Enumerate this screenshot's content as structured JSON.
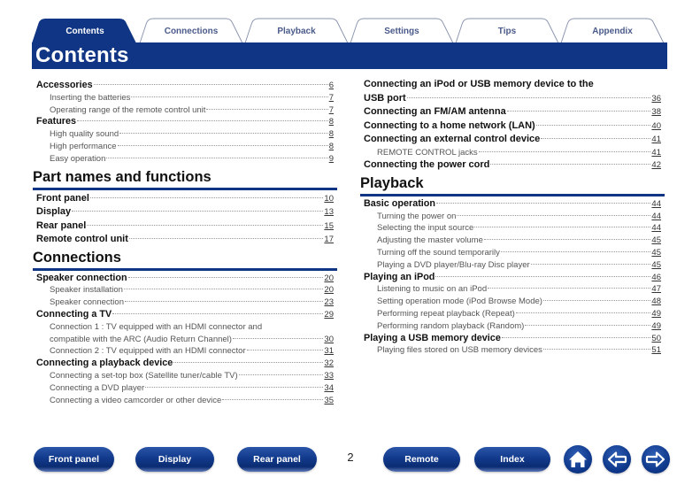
{
  "tabs": [
    {
      "label": "Contents",
      "active": true
    },
    {
      "label": "Connections",
      "active": false
    },
    {
      "label": "Playback",
      "active": false
    },
    {
      "label": "Settings",
      "active": false
    },
    {
      "label": "Tips",
      "active": false
    },
    {
      "label": "Appendix",
      "active": false
    }
  ],
  "page_title": "Contents",
  "colors": {
    "brand": "#0f3584",
    "tab_text": "#4a5a8a"
  },
  "left_column": {
    "intro": [
      {
        "title": "Accessories",
        "page": "6",
        "level": 1
      },
      {
        "title": "Inserting the batteries",
        "page": "7",
        "level": 2
      },
      {
        "title": "Operating range of the remote control unit",
        "page": "7",
        "level": 2
      },
      {
        "title": "Features",
        "page": "8",
        "level": 1
      },
      {
        "title": "High quality sound",
        "page": "8",
        "level": 2
      },
      {
        "title": "High performance",
        "page": "8",
        "level": 2
      },
      {
        "title": "Easy operation",
        "page": "9",
        "level": 2
      }
    ],
    "part_names": {
      "heading": "Part names and functions",
      "items": [
        {
          "title": "Front panel",
          "page": "10",
          "level": 1
        },
        {
          "title": "Display",
          "page": "13",
          "level": 1
        },
        {
          "title": "Rear panel",
          "page": "15",
          "level": 1
        },
        {
          "title": "Remote control unit",
          "page": "17",
          "level": 1
        }
      ]
    },
    "connections": {
      "heading": "Connections",
      "items": [
        {
          "title": "Speaker connection",
          "page": "20",
          "level": 1
        },
        {
          "title": "Speaker installation",
          "page": "20",
          "level": 2
        },
        {
          "title": "Speaker connection",
          "page": "23",
          "level": 2
        },
        {
          "title": "Connecting a TV",
          "page": "29",
          "level": 1
        },
        {
          "title": "Connection 1 : TV equipped with an HDMI connector and",
          "page": "",
          "level": 2
        },
        {
          "title": "compatible with the ARC (Audio Return Channel)",
          "page": "30",
          "level": 2
        },
        {
          "title": "Connection 2 : TV equipped with an HDMI connector",
          "page": "31",
          "level": 2
        },
        {
          "title": "Connecting a playback device",
          "page": "32",
          "level": 1
        },
        {
          "title": "Connecting a set-top box (Satellite tuner/cable TV)",
          "page": "33",
          "level": 2
        },
        {
          "title": "Connecting a DVD player",
          "page": "34",
          "level": 2
        },
        {
          "title": "Connecting a video camcorder or other device",
          "page": "35",
          "level": 2
        }
      ]
    }
  },
  "right_column": {
    "connections_cont": [
      {
        "title": "Connecting an iPod or USB memory device to the",
        "page": "",
        "level": 1
      },
      {
        "title": "USB port",
        "page": "36",
        "level": 1
      },
      {
        "title": "Connecting an FM/AM antenna",
        "page": "38",
        "level": 1
      },
      {
        "title": "Connecting to a home network (LAN)",
        "page": "40",
        "level": 1
      },
      {
        "title": "Connecting an external control device",
        "page": "41",
        "level": 1
      },
      {
        "title": "REMOTE CONTROL jacks",
        "page": "41",
        "level": 2
      },
      {
        "title": "Connecting the power cord",
        "page": "42",
        "level": 1
      }
    ],
    "playback": {
      "heading": "Playback",
      "items": [
        {
          "title": "Basic operation",
          "page": "44",
          "level": 1
        },
        {
          "title": "Turning the power on",
          "page": "44",
          "level": 2
        },
        {
          "title": "Selecting the input source",
          "page": "44",
          "level": 2
        },
        {
          "title": "Adjusting the master volume",
          "page": "45",
          "level": 2
        },
        {
          "title": "Turning off the sound temporarily",
          "page": "45",
          "level": 2
        },
        {
          "title": "Playing a DVD player/Blu-ray Disc player",
          "page": "45",
          "level": 2
        },
        {
          "title": "Playing an iPod",
          "page": "46",
          "level": 1
        },
        {
          "title": "Listening to music on an iPod",
          "page": "47",
          "level": 2
        },
        {
          "title": "Setting operation mode (iPod Browse Mode)",
          "page": "48",
          "level": 2
        },
        {
          "title": "Performing repeat playback (Repeat)",
          "page": "49",
          "level": 2
        },
        {
          "title": "Performing random playback (Random)",
          "page": "49",
          "level": 2
        },
        {
          "title": "Playing a USB memory device",
          "page": "50",
          "level": 1
        },
        {
          "title": "Playing files stored on USB memory devices",
          "page": "51",
          "level": 2
        }
      ]
    }
  },
  "footer": {
    "buttons": [
      "Front panel",
      "Display",
      "Rear panel",
      "Remote",
      "Index"
    ],
    "page_number": "2",
    "icons": [
      "home-icon",
      "arrow-left-icon",
      "arrow-right-icon"
    ]
  }
}
